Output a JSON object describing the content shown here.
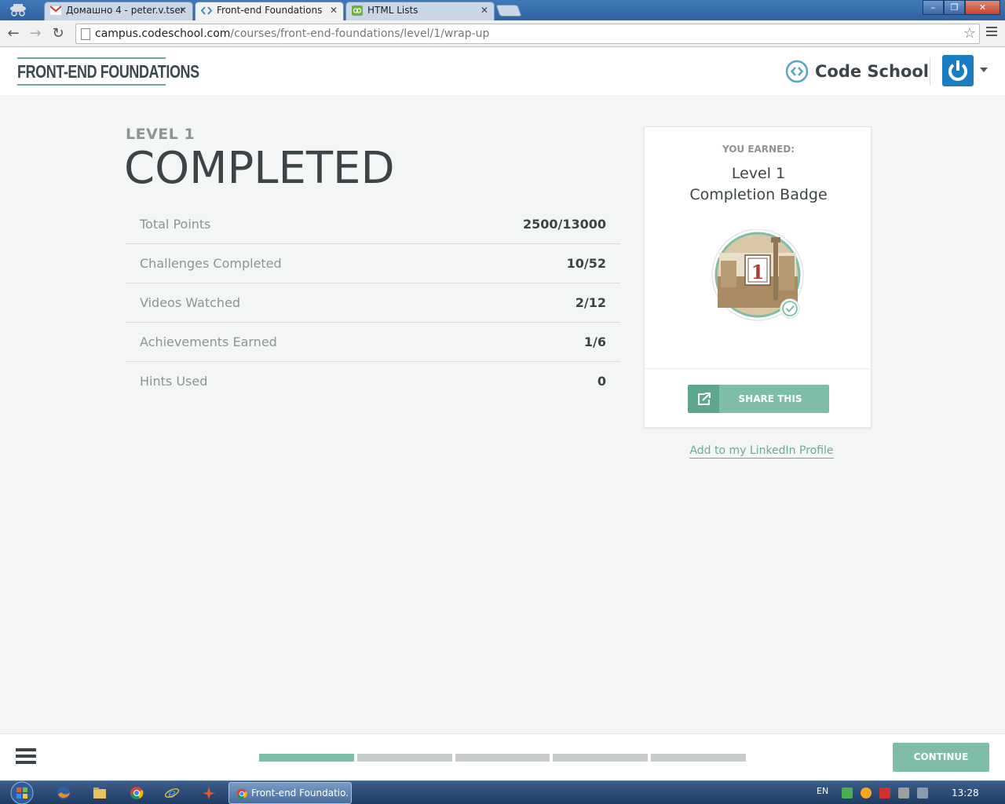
{
  "browser": {
    "tabs": [
      {
        "label": "Домашно 4 - peter.v.tsen",
        "icon": "gmail-icon"
      },
      {
        "label": "Front-end Foundations",
        "icon": "codeschool-icon",
        "active": true
      },
      {
        "label": "HTML Lists",
        "icon": "html-lists-icon"
      }
    ],
    "url_host": "campus.codeschool.com",
    "url_path": "/courses/front-end-foundations/level/1/wrap-up",
    "window_controls": {
      "minimize": "–",
      "maximize": "❐",
      "close": "✕"
    }
  },
  "header": {
    "course_title": "FRONT-END FOUNDATIONS",
    "brand_name": "Code School"
  },
  "main": {
    "level_label": "LEVEL 1",
    "status_title": "COMPLETED",
    "stats": [
      {
        "label": "Total Points",
        "value": "2500/13000"
      },
      {
        "label": "Challenges Completed",
        "value": "10/52"
      },
      {
        "label": "Videos Watched",
        "value": "2/12"
      },
      {
        "label": "Achievements Earned",
        "value": "1/6"
      },
      {
        "label": "Hints Used",
        "value": "0"
      }
    ]
  },
  "badge_card": {
    "earned_label": "YOU EARNED:",
    "badge_title_line1": "Level 1",
    "badge_title_line2": "Completion Badge",
    "badge_number": "1",
    "share_label": "SHARE THIS",
    "linkedin_link": "Add to my LinkedIn Profile"
  },
  "footer": {
    "continue_label": "CONTINUE",
    "progress": {
      "completed_segments": 1,
      "total_segments": 5
    }
  },
  "taskbar": {
    "task_label": "Front-end Foundatio...",
    "language": "EN",
    "clock": "13:28"
  },
  "colors": {
    "accent_green": "#7ebea6",
    "accent_green_dark": "#5ea78c",
    "text_dark": "#3d4447",
    "text_muted": "#8d9496",
    "avatar_blue": "#1b7dc1"
  }
}
